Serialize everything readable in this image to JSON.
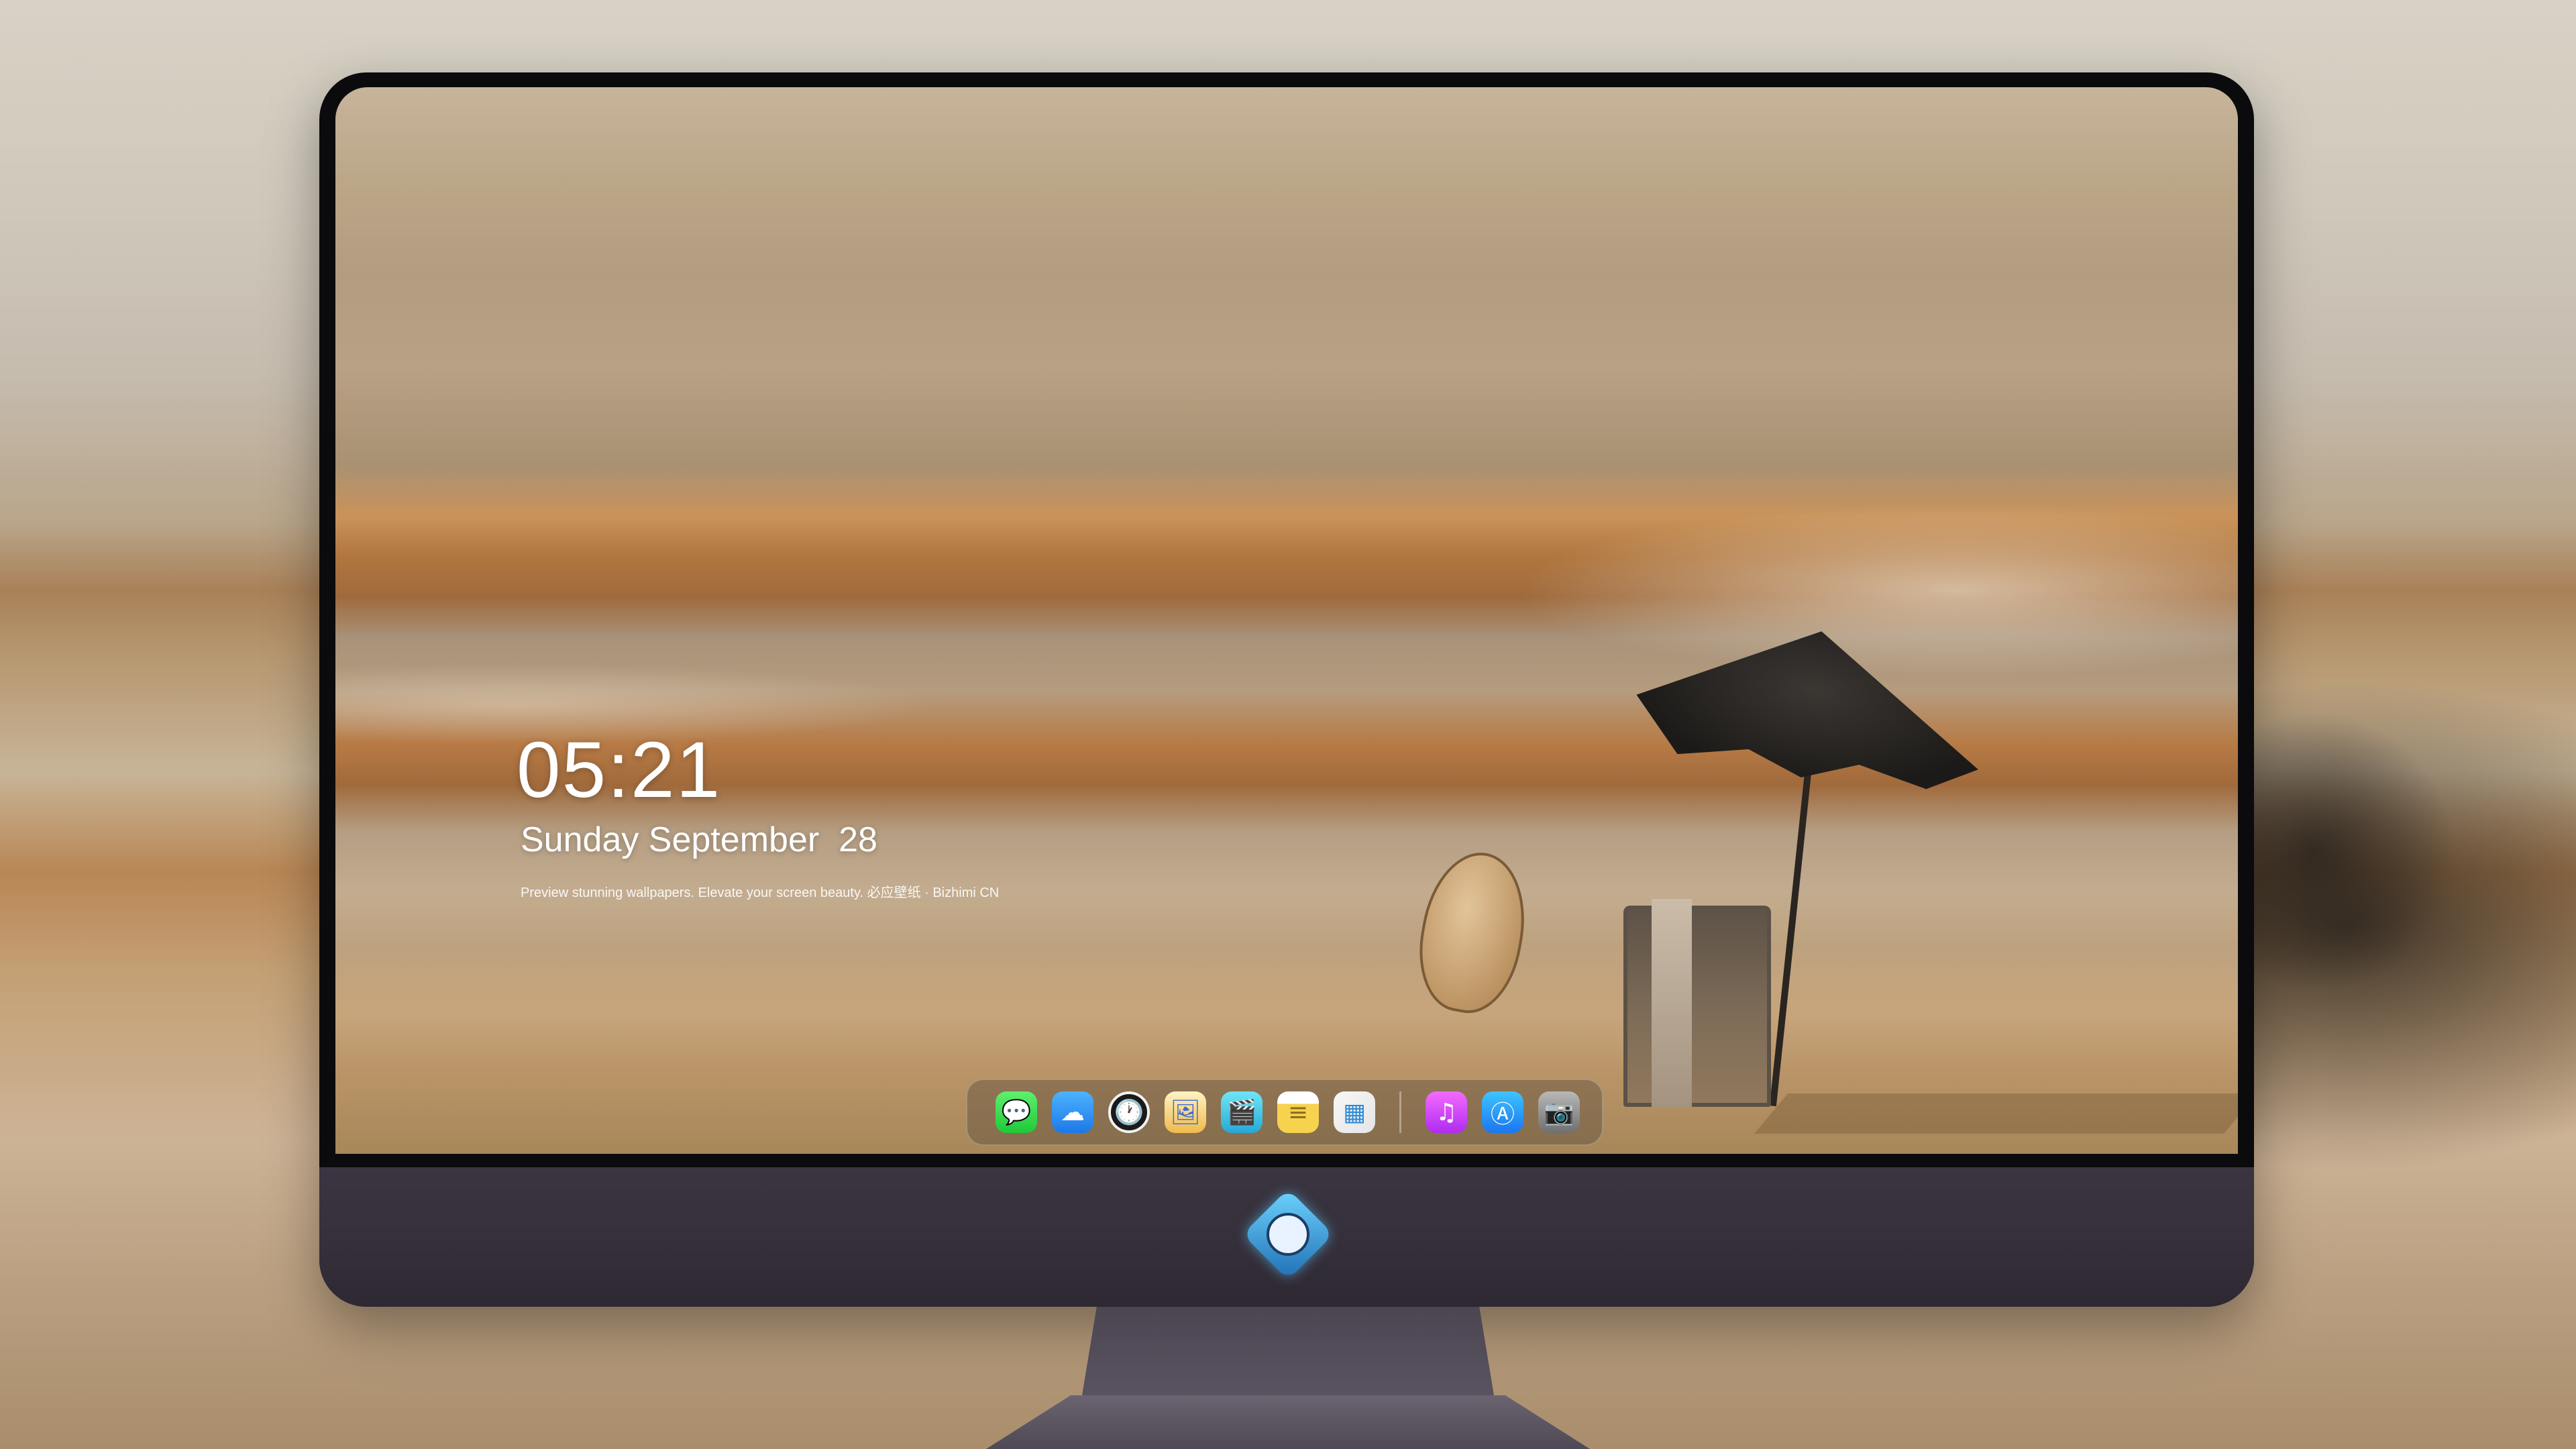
{
  "lock_screen": {
    "time": "05:21",
    "date": "Sunday September  28",
    "caption": "Preview stunning wallpapers. Elevate your screen beauty. 必应壁纸 · Bizhimi CN"
  },
  "dock": {
    "items": [
      {
        "name": "Messages",
        "icon": "messages-icon",
        "glyph": "💬"
      },
      {
        "name": "Weather",
        "icon": "weather-icon",
        "glyph": "☁"
      },
      {
        "name": "Clock",
        "icon": "clock-icon",
        "glyph": "🕐"
      },
      {
        "name": "Preview",
        "icon": "preview-icon",
        "glyph": "🖼"
      },
      {
        "name": "Clips",
        "icon": "clapper-icon",
        "glyph": "🎬"
      },
      {
        "name": "Notes",
        "icon": "notes-icon",
        "glyph": "≡"
      },
      {
        "name": "Photos",
        "icon": "photos-icon",
        "glyph": "▦"
      },
      {
        "name": "Music",
        "icon": "music-icon",
        "glyph": "♫"
      },
      {
        "name": "App Store",
        "icon": "app-store-icon",
        "glyph": "Ⓐ"
      },
      {
        "name": "Camera",
        "icon": "camera-icon",
        "glyph": "📷"
      }
    ]
  },
  "colors": {
    "chin": "#352f3a",
    "bezel": "#0b0b0d",
    "accent_logo": "#6fd3ff"
  }
}
